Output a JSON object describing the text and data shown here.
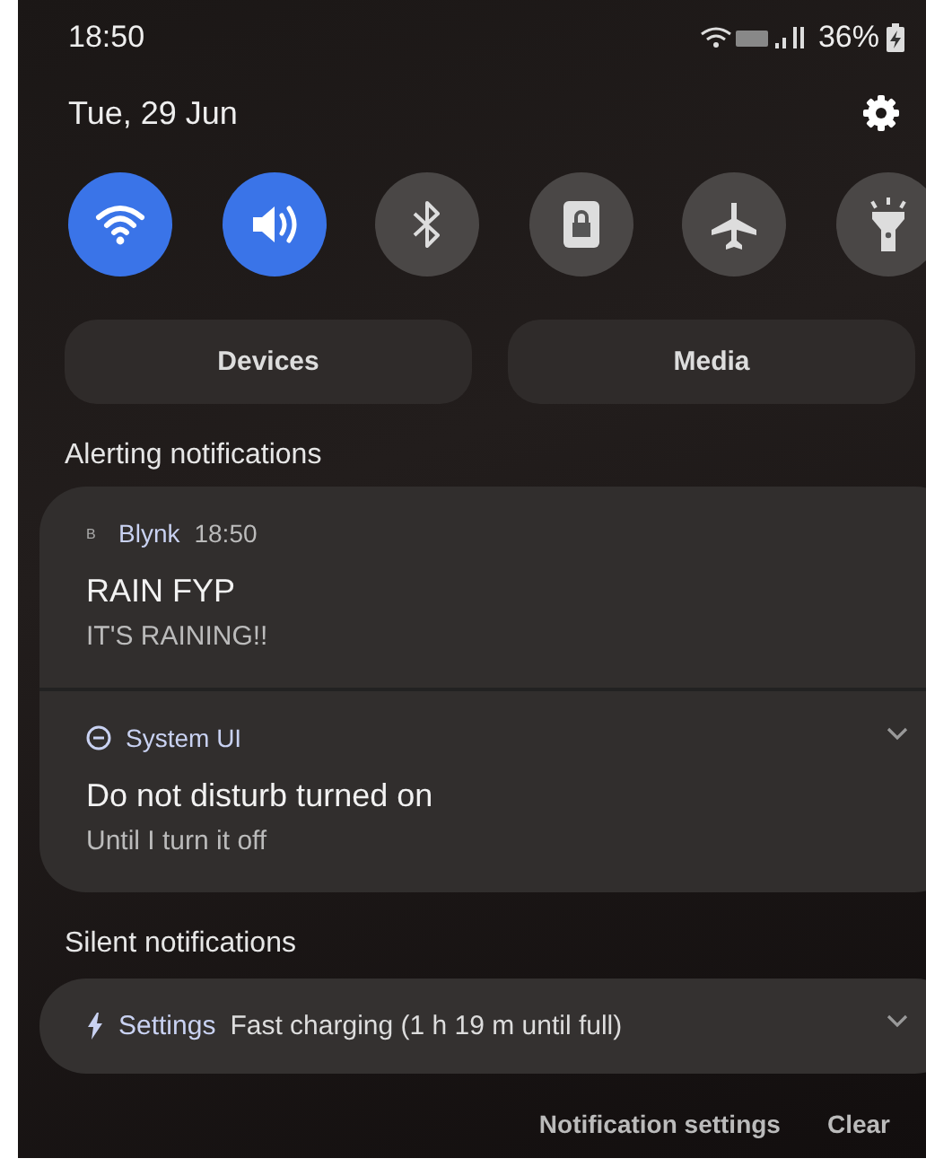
{
  "status_bar": {
    "time": "18:50",
    "battery": "36%"
  },
  "header": {
    "date": "Tue, 29 Jun"
  },
  "quick_tiles": [
    {
      "kind": "wifi",
      "on": true
    },
    {
      "kind": "sound",
      "on": true
    },
    {
      "kind": "bluetooth",
      "on": false
    },
    {
      "kind": "lock",
      "on": false
    },
    {
      "kind": "airplane",
      "on": false
    },
    {
      "kind": "flashlight",
      "on": false
    }
  ],
  "panel_buttons": [
    "Devices",
    "Media"
  ],
  "alerting": {
    "title": "Alerting notifications",
    "notifications": [
      {
        "kind": "letter",
        "icon_letter": "B",
        "app": "Blynk",
        "time": "18:50",
        "title": "RAIN FYP",
        "text": "IT'S RAINING!!",
        "expandable": false
      },
      {
        "kind": "dnd",
        "app": "System UI",
        "title": "Do not disturb turned on",
        "text": "Until I turn it off",
        "expandable": true
      }
    ]
  },
  "silent": {
    "title": "Silent notifications",
    "notifications": [
      {
        "kind": "bolt",
        "app": "Settings",
        "text": "Fast charging (1 h 19 m until full)",
        "expandable": true
      }
    ]
  },
  "footer": [
    "Notification settings",
    "Clear"
  ]
}
